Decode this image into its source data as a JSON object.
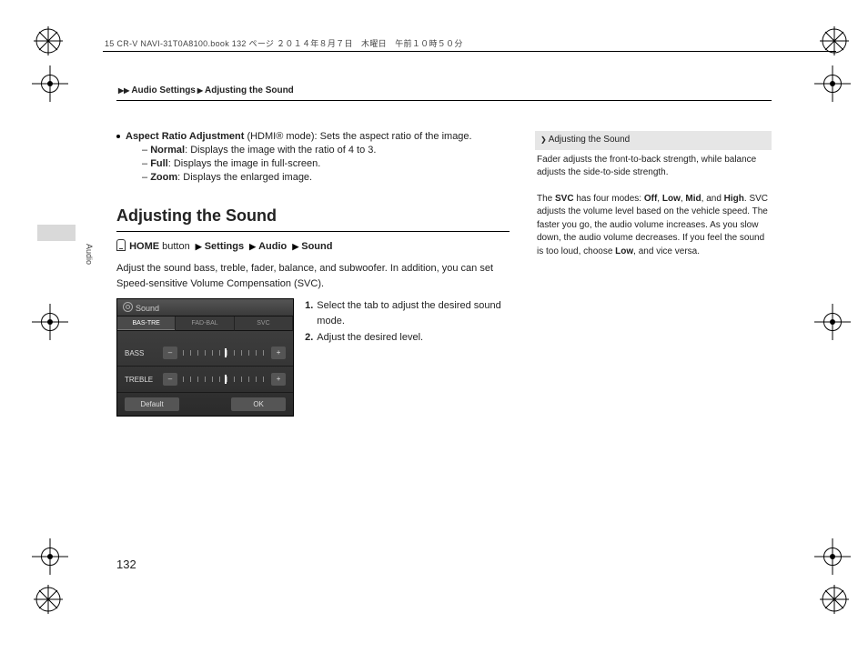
{
  "meta": {
    "header_line": "15 CR-V NAVI-31T0A8100.book  132 ページ  ２０１４年８月７日　木曜日　午前１０時５０分",
    "breadcrumb": [
      "Audio Settings",
      "Adjusting the Sound"
    ],
    "side_tab": "Audio",
    "page_number": "132"
  },
  "aspect_ratio": {
    "lead_bold": "Aspect Ratio Adjustment",
    "lead_rest": " (HDMI® mode): Sets the aspect ratio of the image.",
    "items": [
      {
        "label": "Normal",
        "desc": ": Displays the image with the ratio of 4 to 3."
      },
      {
        "label": "Full",
        "desc": ": Displays the image in full-screen."
      },
      {
        "label": "Zoom",
        "desc": ": Displays the enlarged image."
      }
    ]
  },
  "section": {
    "title": "Adjusting the Sound",
    "nav": {
      "home": "HOME",
      "button_word": "button",
      "path": [
        "Settings",
        "Audio",
        "Sound"
      ]
    },
    "desc": "Adjust the sound bass, treble, fader, balance, and subwoofer. In addition, you can set Speed-sensitive Volume Compensation (SVC).",
    "steps": [
      {
        "n": "1.",
        "t": "Select the tab to adjust the desired sound mode."
      },
      {
        "n": "2.",
        "t": "Adjust the desired level."
      }
    ]
  },
  "screenshot": {
    "title": "Sound",
    "tabs": [
      "BAS-TRE",
      "FAD-BAL",
      "SVC"
    ],
    "rows": [
      {
        "label": "BASS",
        "minus": "–",
        "plus": "+",
        "pointer_pct": 50
      },
      {
        "label": "TREBLE",
        "minus": "–",
        "plus": "+",
        "pointer_pct": 50
      }
    ],
    "footer": {
      "default": "Default",
      "ok": "OK"
    }
  },
  "sidebar": {
    "title": "Adjusting the Sound",
    "p1": "Fader adjusts the front-to-back strength, while balance adjusts the side-to-side strength.",
    "p2_pre": "The ",
    "p2_svc": "SVC",
    "p2_mid": " has four modes: ",
    "modes": [
      "Off",
      "Low",
      "Mid",
      "High"
    ],
    "p2_post": ". SVC adjusts the volume level based on the vehicle speed. The faster you go, the audio volume increases. As you slow down, the audio volume decreases. If you feel the sound is too loud, choose ",
    "p2_low": "Low",
    "p2_tail": ", and vice versa."
  }
}
